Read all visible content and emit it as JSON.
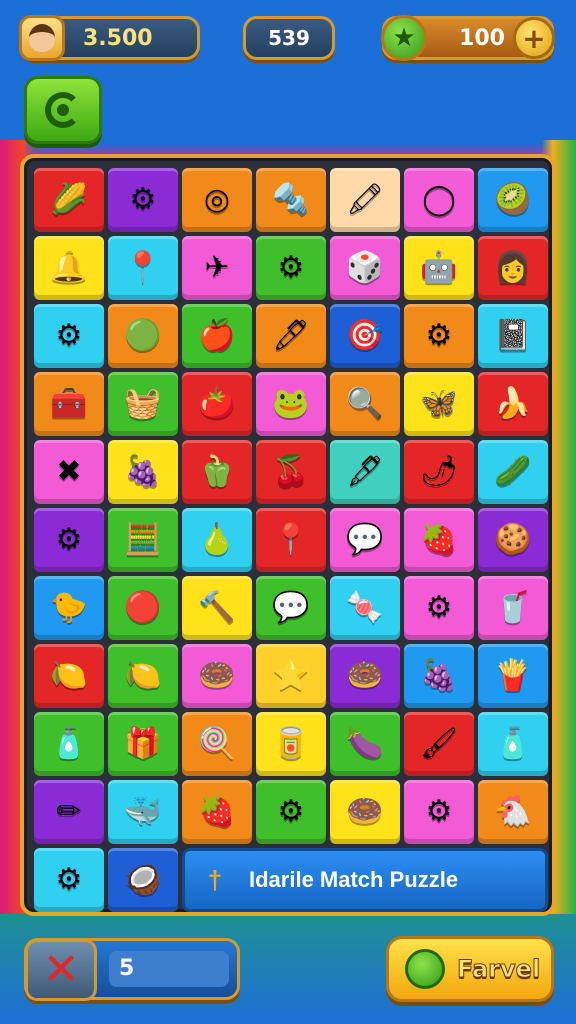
{
  "hud": {
    "coins": "3.500",
    "center_value": "539",
    "gems": "100",
    "plus_symbol": "+"
  },
  "board": {
    "rows": [
      [
        {
          "c": "#e52626",
          "i": "🌽"
        },
        {
          "c": "#8a2bd6",
          "i": "⚙"
        },
        {
          "c": "#f28a1a",
          "i": "◎"
        },
        {
          "c": "#f28a1a",
          "i": "🔩"
        },
        {
          "c": "#ffd9a8",
          "i": "🖍"
        },
        {
          "c": "#f25ad6",
          "i": "◯"
        },
        {
          "c": "#1f9af0",
          "i": "🥝"
        }
      ],
      [
        {
          "c": "#ffe21a",
          "i": "🔔"
        },
        {
          "c": "#2fd0f0",
          "i": "📍"
        },
        {
          "c": "#f25ad6",
          "i": "✈"
        },
        {
          "c": "#3fbf2a",
          "i": "⚙"
        },
        {
          "c": "#f25ad6",
          "i": "🎲"
        },
        {
          "c": "#ffe21a",
          "i": "🤖"
        },
        {
          "c": "#e52626",
          "i": "👩"
        }
      ],
      [
        {
          "c": "#2fd0f0",
          "i": "⚙"
        },
        {
          "c": "#f28a1a",
          "i": "🟢"
        },
        {
          "c": "#3fbf2a",
          "i": "🍎"
        },
        {
          "c": "#f28a1a",
          "i": "🖊"
        },
        {
          "c": "#1f5fd6",
          "i": "🎯"
        },
        {
          "c": "#f28a1a",
          "i": "⚙"
        },
        {
          "c": "#2fd0f0",
          "i": "📓"
        }
      ],
      [
        {
          "c": "#f28a1a",
          "i": "🧰"
        },
        {
          "c": "#3fbf2a",
          "i": "🧺"
        },
        {
          "c": "#e52626",
          "i": "🍅"
        },
        {
          "c": "#f25ad6",
          "i": "🐸"
        },
        {
          "c": "#f28a1a",
          "i": "🔍"
        },
        {
          "c": "#ffe21a",
          "i": "🦋"
        },
        {
          "c": "#e52626",
          "i": "🍌"
        }
      ],
      [
        {
          "c": "#f25ad6",
          "i": "✖"
        },
        {
          "c": "#ffe21a",
          "i": "🍇"
        },
        {
          "c": "#e52626",
          "i": "🫑"
        },
        {
          "c": "#e52626",
          "i": "🍒"
        },
        {
          "c": "#3fd0c0",
          "i": "🖋"
        },
        {
          "c": "#e52626",
          "i": "🌶"
        },
        {
          "c": "#2fd0f0",
          "i": "🥒"
        }
      ],
      [
        {
          "c": "#8a2bd6",
          "i": "⚙"
        },
        {
          "c": "#3fbf2a",
          "i": "🧮"
        },
        {
          "c": "#2fd0f0",
          "i": "🍐"
        },
        {
          "c": "#e52626",
          "i": "📍"
        },
        {
          "c": "#f25ad6",
          "i": "💬"
        },
        {
          "c": "#f25ad6",
          "i": "🍓"
        },
        {
          "c": "#8a2bd6",
          "i": "🍪"
        }
      ],
      [
        {
          "c": "#1f9af0",
          "i": "🐤"
        },
        {
          "c": "#3fbf2a",
          "i": "🔴"
        },
        {
          "c": "#ffe21a",
          "i": "🔨"
        },
        {
          "c": "#3fbf2a",
          "i": "💬"
        },
        {
          "c": "#2fd0f0",
          "i": "🍬"
        },
        {
          "c": "#f25ad6",
          "i": "⚙"
        },
        {
          "c": "#f25ad6",
          "i": "🥤"
        }
      ],
      [
        {
          "c": "#e52626",
          "i": "🍋"
        },
        {
          "c": "#3fbf2a",
          "i": "🍋"
        },
        {
          "c": "#f25ad6",
          "i": "🍩"
        },
        {
          "c": "#ffd02a",
          "i": "⭐"
        },
        {
          "c": "#8a2bd6",
          "i": "🍩"
        },
        {
          "c": "#1f9af0",
          "i": "🍇"
        },
        {
          "c": "#1f9af0",
          "i": "🍟"
        }
      ],
      [
        {
          "c": "#3fbf2a",
          "i": "🧴"
        },
        {
          "c": "#3fbf2a",
          "i": "🎁"
        },
        {
          "c": "#f28a1a",
          "i": "🍭"
        },
        {
          "c": "#ffe21a",
          "i": "🥫"
        },
        {
          "c": "#3fbf2a",
          "i": "🍆"
        },
        {
          "c": "#e52626",
          "i": "🖌"
        },
        {
          "c": "#2fd0f0",
          "i": "🧴"
        }
      ],
      [
        {
          "c": "#8a2bd6",
          "i": "✏"
        },
        {
          "c": "#2fd0f0",
          "i": "🐳"
        },
        {
          "c": "#f28a1a",
          "i": "🍓"
        },
        {
          "c": "#3fbf2a",
          "i": "⚙"
        },
        {
          "c": "#ffe21a",
          "i": "🍩"
        },
        {
          "c": "#f25ad6",
          "i": "⚙"
        },
        {
          "c": "#f28a1a",
          "i": "🐔"
        }
      ],
      [
        {
          "c": "#2fd0f0",
          "i": "⚙"
        },
        {
          "c": "#1f5fd6",
          "i": "🥥"
        }
      ]
    ],
    "banner_text": "Idarile Match Puzzle",
    "banner_icon": "†"
  },
  "footer": {
    "close_symbol": "✕",
    "moves": "5",
    "action_label": "Farvel"
  },
  "colors": {
    "gold_border": "#d69a2a",
    "hud_navy": "#23405f",
    "banner_blue": "#2c8ef0",
    "action_yellow": "#ffe14a"
  }
}
